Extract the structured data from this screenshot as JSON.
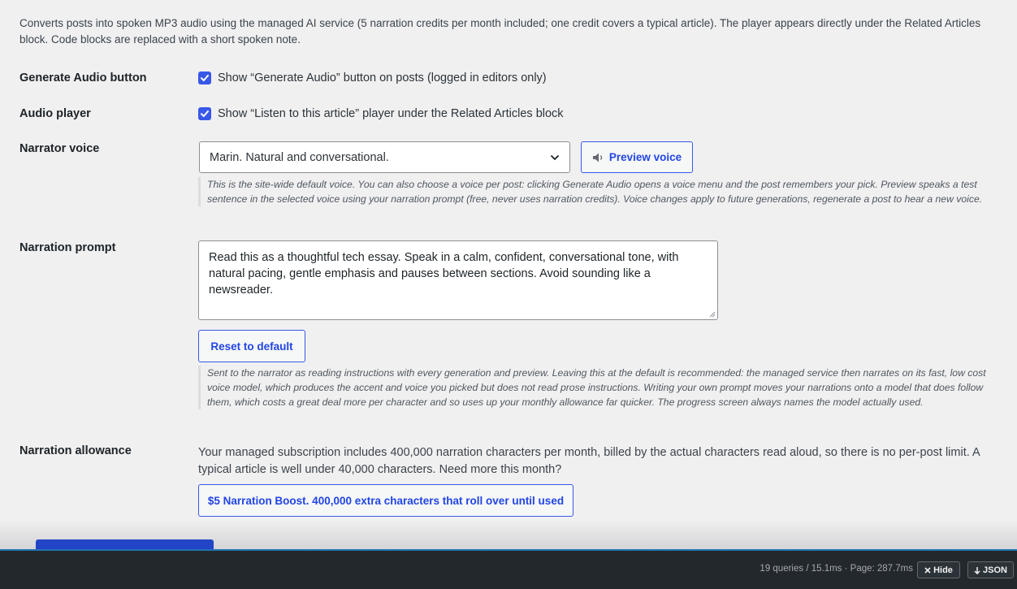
{
  "intro": "Converts posts into spoken MP3 audio using the managed AI service (5 narration credits per month included; one credit covers a typical article). The player appears directly under the Related Articles block. Code blocks are replaced with a short spoken note.",
  "generate_audio": {
    "label": "Generate Audio button",
    "checkbox_label": "Show “Generate Audio” button on posts (logged in editors only)",
    "checked": true
  },
  "audio_player": {
    "label": "Audio player",
    "checkbox_label": "Show “Listen to this article” player under the Related Articles block",
    "checked": true
  },
  "narrator_voice": {
    "label": "Narrator voice",
    "selected": "Marin. Natural and conversational.",
    "preview_button": "Preview voice",
    "help": "This is the site-wide default voice. You can also choose a voice per post: clicking Generate Audio opens a voice menu and the post remembers your pick. Preview speaks a test sentence in the selected voice using your narration prompt (free, never uses narration credits). Voice changes apply to future generations, regenerate a post to hear a new voice."
  },
  "narration_prompt": {
    "label": "Narration prompt",
    "value": "Read this as a thoughtful tech essay. Speak in a calm, confident, conversational tone, with natural pacing, gentle emphasis and pauses between sections. Avoid sounding like a newsreader.",
    "reset_button": "Reset to default",
    "help": "Sent to the narrator as reading instructions with every generation and preview. Leaving this at the default is recommended: the managed service then narrates on its fast, low cost voice model, which produces the accent and voice you picked but does not read prose instructions. Writing your own prompt moves your narrations onto a model that does follow them, which costs a great deal more per character and so uses up your monthly allowance far quicker. The progress screen always names the model actually used."
  },
  "narration_allowance": {
    "label": "Narration allowance",
    "text": "Your managed subscription includes 400,000 narration characters per month, billed by the actual characters read aloud, so there is no per-post limit. A typical article is well under 40,000 characters. Need more this month?",
    "boost_button": "$5 Narration Boost. 400,000 extra characters that roll over until used"
  },
  "toolbar": {
    "stats": "19 queries / 15.1ms · Page: 287.7ms",
    "hide": "Hide",
    "json": "JSON"
  },
  "colors": {
    "accent": "#3858e9",
    "button_text": "#2145e6",
    "toolbar_bg": "#23282d"
  }
}
